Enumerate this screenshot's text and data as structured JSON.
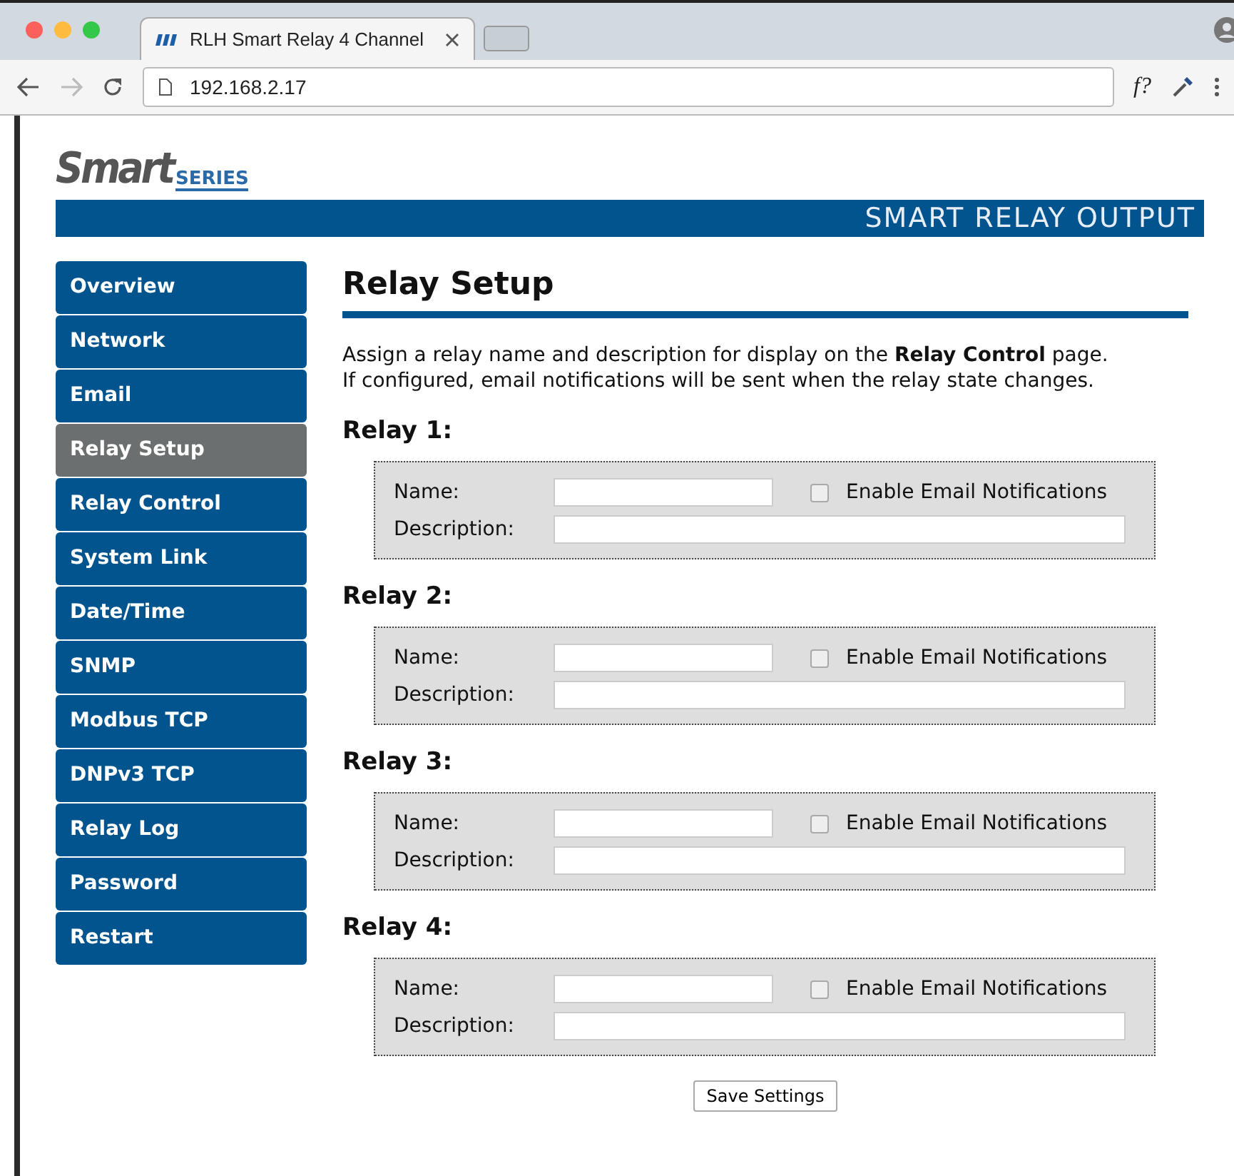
{
  "browser": {
    "tab_title": "RLH Smart Relay 4 Channel",
    "url": "192.168.2.17",
    "extension_label": "f?"
  },
  "logo": {
    "word": "Smart",
    "sub": "SERIES"
  },
  "banner": "SMART RELAY OUTPUT",
  "nav": [
    {
      "label": "Overview",
      "selected": false
    },
    {
      "label": "Network",
      "selected": false
    },
    {
      "label": "Email",
      "selected": false
    },
    {
      "label": "Relay Setup",
      "selected": true
    },
    {
      "label": "Relay Control",
      "selected": false
    },
    {
      "label": "System Link",
      "selected": false
    },
    {
      "label": "Date/Time",
      "selected": false
    },
    {
      "label": "SNMP",
      "selected": false
    },
    {
      "label": "Modbus TCP",
      "selected": false
    },
    {
      "label": "DNPv3 TCP",
      "selected": false
    },
    {
      "label": "Relay Log",
      "selected": false
    },
    {
      "label": "Password",
      "selected": false
    },
    {
      "label": "Restart",
      "selected": false
    }
  ],
  "title": "Relay Setup",
  "intro": [
    "Assign a relay name and description for display on the **Relay Control** page.",
    "If configured, email notifications will be sent when the relay state changes."
  ],
  "relays": [
    {
      "heading": "Relay 1:",
      "name_label": "Name:",
      "email_label": "Enable Email Notifications",
      "email_checked": false,
      "description_label": "Description:"
    },
    {
      "heading": "Relay 2:",
      "name_label": "Name:",
      "email_label": "Enable Email Notifications",
      "email_checked": false,
      "description_label": "Description:"
    },
    {
      "heading": "Relay 3:",
      "name_label": "Name:",
      "email_label": "Enable Email Notifications",
      "email_checked": false,
      "description_label": "Description:"
    },
    {
      "heading": "Relay 4:",
      "name_label": "Name:",
      "email_label": "Enable Email Notifications",
      "email_checked": false,
      "description_label": "Description:"
    }
  ],
  "save_button": "Save Settings"
}
